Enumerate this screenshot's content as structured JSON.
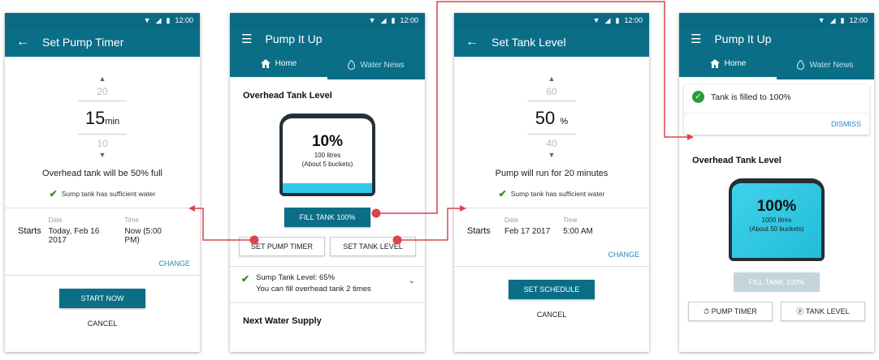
{
  "status": {
    "time": "12:00"
  },
  "screen1": {
    "title": "Set Pump Timer",
    "picker": {
      "above": "20",
      "value": "15",
      "unit": "min",
      "below": "10"
    },
    "message": "Overhead tank will be 50% full",
    "sufficient": "Sump tank has sufficient water",
    "starts_label": "Starts",
    "date_label": "Date",
    "date_value": "Today, Feb 16 2017",
    "time_label": "Time",
    "time_value": "Now (5:00 PM)",
    "change": "CHANGE",
    "primary": "START NOW",
    "cancel": "CANCEL"
  },
  "screen2": {
    "title": "Pump It Up",
    "tabs": {
      "home": "Home",
      "news": "Water News"
    },
    "tank_label": "Overhead Tank Level",
    "tank": {
      "percent": "10%",
      "litres": "100 litres",
      "buckets": "(About 5 buckets)",
      "fill_fraction": 0.1
    },
    "fill_button": "FILL TANK 100%",
    "set_pump_timer": "SET PUMP TIMER",
    "set_tank_level": "SET TANK LEVEL",
    "sump_level": "Sump Tank Level: 65%",
    "sump_detail": "You can fill overhead tank 2 times",
    "next_supply": "Next Water Supply"
  },
  "screen3": {
    "title": "Set Tank Level",
    "picker": {
      "above": "60",
      "value": "50",
      "unit": "%",
      "below": "40"
    },
    "message": "Pump will run for 20 minutes",
    "sufficient": "Sump tank has sufficient water",
    "starts_label": "Starts",
    "date_label": "Date",
    "date_value": "Feb 17 2017",
    "time_label": "Time",
    "time_value": "5:00 AM",
    "change": "CHANGE",
    "primary": "SET SCHEDULE",
    "cancel": "CANCEL"
  },
  "screen4": {
    "title": "Pump It Up",
    "tabs": {
      "home": "Home",
      "news": "Water News"
    },
    "notice": "Tank is filled to 100%",
    "dismiss": "DISMISS",
    "tank_label": "Overhead Tank Level",
    "tank": {
      "percent": "100%",
      "litres": "1000 litres",
      "buckets": "(About 50 buckets)",
      "fill_fraction": 1.0
    },
    "fill_button": "FILL TANK 100%",
    "pump_timer": "PUMP TIMER",
    "tank_level": "TANK LEVEL"
  },
  "colors": {
    "appbar": "#0b6e87",
    "accent_link": "#2a86b8",
    "connector": "#d9454c",
    "water": "#2ec9e6",
    "check": "#3a8a24"
  }
}
